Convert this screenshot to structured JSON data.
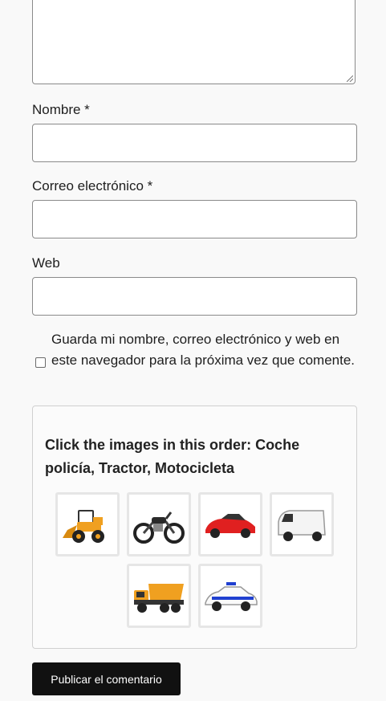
{
  "form": {
    "name_label": "Nombre *",
    "email_label": "Correo electrónico *",
    "web_label": "Web",
    "name_value": "",
    "email_value": "",
    "web_value": "",
    "consent_text": "Guarda mi nombre, correo electrónico y web en este navegador para la próxima vez que comente.",
    "consent_checked": false,
    "submit_label": "Publicar el comentario"
  },
  "captcha": {
    "instruction": "Click the images in this order: Coche policía, Tractor, Motocicleta",
    "tiles": [
      {
        "icon": "loader-tractor-icon"
      },
      {
        "icon": "motorcycle-icon"
      },
      {
        "icon": "sports-car-icon"
      },
      {
        "icon": "van-icon"
      },
      {
        "icon": "dump-truck-icon"
      },
      {
        "icon": "police-car-icon"
      }
    ]
  },
  "colors": {
    "accent": "#111111",
    "border": "#8a8a8a",
    "background": "#f9f9f9"
  }
}
